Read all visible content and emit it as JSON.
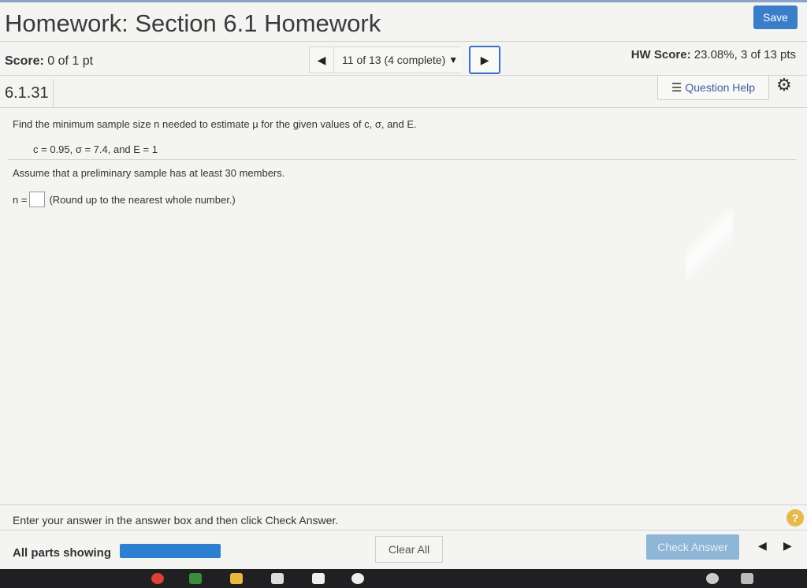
{
  "header": {
    "title": "Homework: Section 6.1 Homework",
    "save_label": "Save"
  },
  "status": {
    "score_label": "Score:",
    "score_value": "0 of 1 pt",
    "nav_label": "11 of 13 (4 complete)",
    "hw_score_label": "HW Score:",
    "hw_score_value": "23.08%, 3 of 13 pts"
  },
  "question": {
    "number": "6.1.31",
    "help_label": "Question Help",
    "prompt": "Find the minimum sample size n needed to estimate μ for the given values of c, σ, and E.",
    "givens": "c = 0.95, σ = 7.4, and E = 1",
    "assumption": "Assume that a preliminary sample has at least 30 members.",
    "answer_prefix": "n =",
    "answer_value": "",
    "answer_hint": "(Round up to the nearest whole number.)"
  },
  "footer": {
    "instruction": "Enter your answer in the answer box and then click Check Answer.",
    "parts_label": "All parts showing",
    "clear_label": "Clear All",
    "check_label": "Check Answer",
    "help_mark": "?"
  },
  "icons": {
    "prev": "triangle-left",
    "next": "triangle-right",
    "dropdown": "triangle-down",
    "list": "list-icon",
    "gear": "gear-icon"
  },
  "colors": {
    "accent": "#3a7dc8",
    "progress": "#2f7fd0",
    "check_disabled": "#8fb6d6",
    "help_mark": "#e6b94a"
  }
}
